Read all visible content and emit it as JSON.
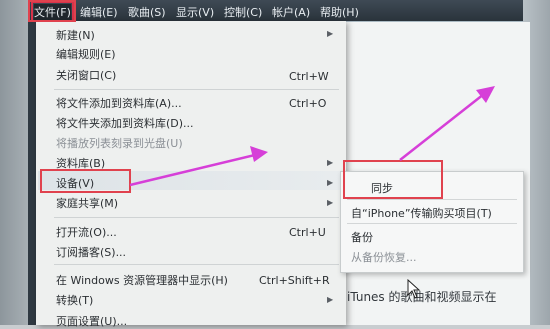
{
  "menubar": {
    "items": [
      "文件(F)",
      "编辑(E)",
      "歌曲(S)",
      "显示(V)",
      "控制(C)",
      "帐户(A)",
      "帮助(H)"
    ]
  },
  "file_menu": {
    "new": "新建(N)",
    "edit_rules": "编辑规则(E)",
    "close_window": "关闭窗口(C)",
    "close_window_shortcut": "Ctrl+W",
    "add_file": "将文件添加到资料库(A)...",
    "add_file_shortcut": "Ctrl+O",
    "add_folder": "将文件夹添加到资料库(D)...",
    "burn_playlist": "将播放列表刻录到光盘(U)",
    "library": "资料库(B)",
    "devices": "设备(V)",
    "home_sharing": "家庭共享(M)",
    "open_stream": "打开流(O)...",
    "open_stream_shortcut": "Ctrl+U",
    "subscribe_podcast": "订阅播客(S)...",
    "show_in_explorer": "在 Windows 资源管理器中显示(H)",
    "show_in_explorer_shortcut": "Ctrl+Shift+R",
    "convert": "转换(T)",
    "page_setup": "页面设置(U)..."
  },
  "devices_submenu": {
    "sync": "同步",
    "transfer_purchases": "自“iPhone”传输购买项目(T)",
    "backup": "备份",
    "restore_backup": "从备份恢复..."
  },
  "background": {
    "bottom_text": "iTunes 的歌曲和视频显示在"
  },
  "colors": {
    "annotation_red": "#e0424e",
    "arrow_magenta": "#d63fd8"
  }
}
